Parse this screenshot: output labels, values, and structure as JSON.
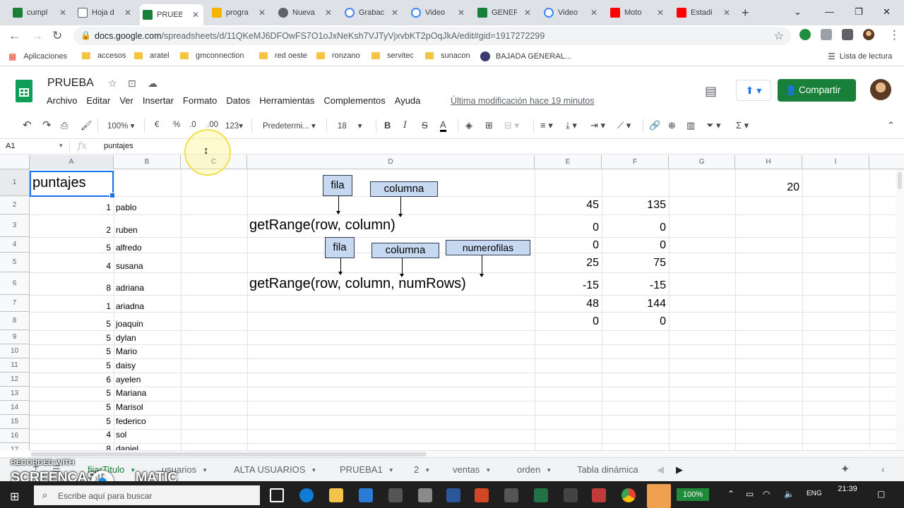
{
  "browser": {
    "tabs": [
      {
        "label": "cumpl",
        "color": "#188038"
      },
      {
        "label": "Hoja d",
        "color": "#5f6368"
      },
      {
        "label": "PRUEB",
        "color": "#188038",
        "active": true
      },
      {
        "label": "progra",
        "color": "#f4b400"
      },
      {
        "label": "Nueva",
        "color": "#5f6368"
      },
      {
        "label": "Grabac",
        "color": "#4285f4"
      },
      {
        "label": "Video",
        "color": "#4285f4"
      },
      {
        "label": "GENER",
        "color": "#188038"
      },
      {
        "label": "Video",
        "color": "#4285f4"
      },
      {
        "label": "Moto",
        "color": "#ff0000"
      },
      {
        "label": "Estadi",
        "color": "#ff0000"
      }
    ],
    "url_domain": "docs.google.com",
    "url_path": "/spreadsheets/d/11QKeMJ6DFOwFS7O1oJxNeKsh7VJTyVjxvbKT2pOqJkA/edit#gid=1917272299"
  },
  "bookmarks": {
    "apps_label": "Aplicaciones",
    "items": [
      "accesos",
      "aratel",
      "gmconnection",
      "red oeste",
      "ronzano",
      "servitec",
      "sunacon",
      "BAJADA GENERAL..."
    ],
    "reading_list": "Lista de lectura"
  },
  "sheets": {
    "title": "PRUEBA",
    "menus": [
      "Archivo",
      "Editar",
      "Ver",
      "Insertar",
      "Formato",
      "Datos",
      "Herramientas",
      "Complementos",
      "Ayuda"
    ],
    "last_edit": "Última modificación hace 19 minutos",
    "share_label": "Compartir"
  },
  "toolbar": {
    "zoom": "100%",
    "currency": "€",
    "percent": "%",
    "dec_less": ".0",
    "dec_more": ".00",
    "more_formats": "123",
    "font": "Predetermi...",
    "font_size": "18",
    "bold": "B",
    "italic": "I",
    "strike": "S",
    "text_color": "A"
  },
  "formula_bar": {
    "name_box": "A1",
    "fx": "fx",
    "content": "puntajes"
  },
  "grid": {
    "columns": [
      "A",
      "B",
      "C",
      "D",
      "E",
      "F",
      "G",
      "H",
      "I"
    ],
    "rows": [
      "1",
      "2",
      "3",
      "4",
      "5",
      "6",
      "7",
      "8",
      "9",
      "10",
      "11",
      "12",
      "13",
      "14",
      "15",
      "16",
      "17"
    ],
    "a1": "puntajes",
    "h1": "20",
    "col_a_nums": [
      "1",
      "2",
      "5",
      "4",
      "8",
      "1",
      "5",
      "5",
      "5",
      "5",
      "6",
      "5",
      "5",
      "5",
      "4",
      "8"
    ],
    "col_b_names": [
      "pablo",
      "ruben",
      "alfredo",
      "susana",
      "adriana",
      "ariadna",
      "joaquin",
      "dylan",
      "Mario",
      "daisy",
      "ayelen",
      "Mariana",
      "Marisol",
      "federico",
      "sol",
      "daniel"
    ],
    "col_e": [
      "45",
      "0",
      "0",
      "25",
      "-15",
      "48",
      "0"
    ],
    "col_f": [
      "135",
      "0",
      "0",
      "75",
      "-15",
      "144",
      "0"
    ]
  },
  "annotations": {
    "box_fila_1": "fila",
    "box_columna_1": "columna",
    "code_1": "getRange(row, column)",
    "box_fila_2": "fila",
    "box_columna_2": "columna",
    "box_numerofilas": "numerofilas",
    "code_2": "getRange(row, column, numRows)"
  },
  "sheet_tabs": [
    "fijarTitulo",
    "usuarios",
    "ALTA USUARIOS",
    "PRUEBA1",
    "2",
    "ventas",
    "orden",
    "Tabla dinámica"
  ],
  "watermark": {
    "line1": "RECORDED WITH",
    "line2": "SCREENCAST",
    "line3": "MATIC"
  },
  "taskbar": {
    "search_placeholder": "Escribe aquí para buscar",
    "battery": "100%",
    "lang": "ENG",
    "time": "21:39"
  }
}
